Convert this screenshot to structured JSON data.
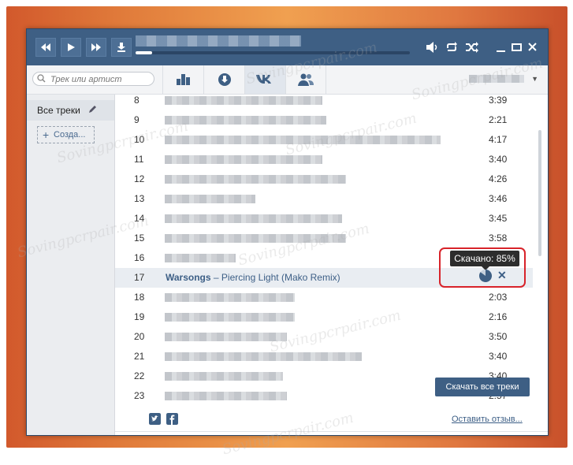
{
  "search": {
    "placeholder": "Трек или артист"
  },
  "sidebar": {
    "all_tracks": "Все треки",
    "create": "Созда..."
  },
  "tracks": [
    {
      "num": "8",
      "duration": "3:39"
    },
    {
      "num": "9",
      "duration": "2:21"
    },
    {
      "num": "10",
      "duration": "4:17"
    },
    {
      "num": "11",
      "duration": "3:40"
    },
    {
      "num": "12",
      "duration": "4:26"
    },
    {
      "num": "13",
      "duration": "3:46"
    },
    {
      "num": "14",
      "duration": "3:45"
    },
    {
      "num": "15",
      "duration": "3:58"
    },
    {
      "num": "16",
      "duration": ""
    },
    {
      "num": "17",
      "duration": "",
      "artist": "Warsongs",
      "separator": " – ",
      "title": "Piercing Light (Mako Remix)"
    },
    {
      "num": "18",
      "duration": "2:03"
    },
    {
      "num": "19",
      "duration": "2:16"
    },
    {
      "num": "20",
      "duration": "3:50"
    },
    {
      "num": "21",
      "duration": "3:40"
    },
    {
      "num": "22",
      "duration": "3:40"
    },
    {
      "num": "23",
      "duration": "2:57"
    }
  ],
  "download": {
    "status": "Скачано: 85%",
    "progress_percent": 85
  },
  "download_all": "Скачать все треки",
  "footer": {
    "review": "Оставить отзыв..."
  },
  "playback": {
    "progress_percent": 6
  },
  "watermark": "Sovingpcrpair.com",
  "colors": {
    "accent": "#3e5f84",
    "highlight": "#d8232a"
  },
  "icons": {
    "prev": "rewind-icon",
    "play": "play-icon",
    "next": "fast-forward-icon",
    "download": "download-icon",
    "volume": "volume-icon",
    "repeat": "repeat-icon",
    "shuffle": "shuffle-icon",
    "minimize": "minimize-icon",
    "maximize": "maximize-icon",
    "close": "close-icon"
  }
}
